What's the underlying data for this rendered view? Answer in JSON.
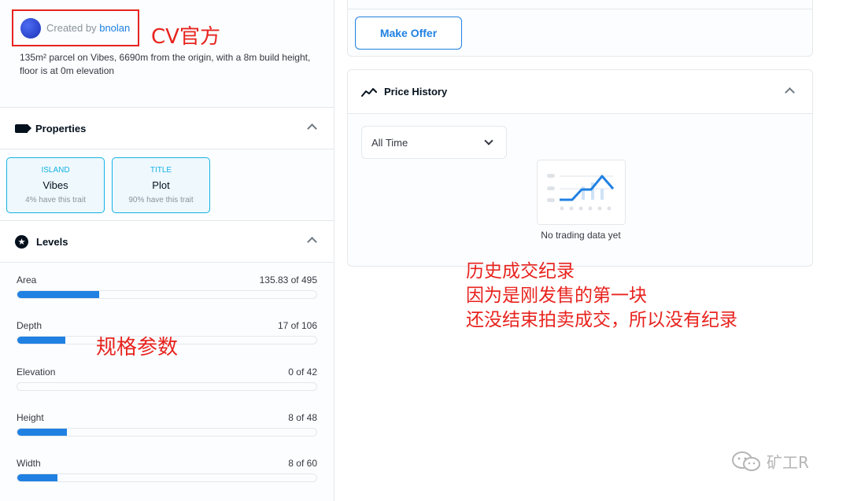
{
  "creator": {
    "prefix": "Created by",
    "name": "bnolan"
  },
  "annotations": {
    "cv_official": "CV官方",
    "specs": "规格参数",
    "history_lines": [
      "历史成交纪录",
      "因为是刚发售的第一块",
      "还没结束拍卖成交，所以没有纪录"
    ]
  },
  "description": "135m² parcel on Vibes, 6690m from the origin, with a 8m build height, floor is at 0m elevation",
  "properties": {
    "title": "Properties",
    "items": [
      {
        "type": "ISLAND",
        "value": "Vibes",
        "rarity": "4% have this trait"
      },
      {
        "type": "TITLE",
        "value": "Plot",
        "rarity": "90% have this trait"
      }
    ]
  },
  "levels": {
    "title": "Levels",
    "items": [
      {
        "name": "Area",
        "display": "135.83 of 495",
        "value": 135.83,
        "max": 495
      },
      {
        "name": "Depth",
        "display": "17 of 106",
        "value": 17,
        "max": 106
      },
      {
        "name": "Elevation",
        "display": "0 of 42",
        "value": 0,
        "max": 42
      },
      {
        "name": "Height",
        "display": "8 of 48",
        "value": 8,
        "max": 48
      },
      {
        "name": "Width",
        "display": "8 of 60",
        "value": 8,
        "max": 60
      }
    ]
  },
  "offer": {
    "button_label": "Make Offer"
  },
  "price_history": {
    "title": "Price History",
    "filter_value": "All Time",
    "empty_text": "No trading data yet"
  },
  "watermark": {
    "text": "矿工R"
  },
  "colors": {
    "accent": "#2081e2",
    "annotation": "#e8231e",
    "trait": "#15b2e5"
  }
}
